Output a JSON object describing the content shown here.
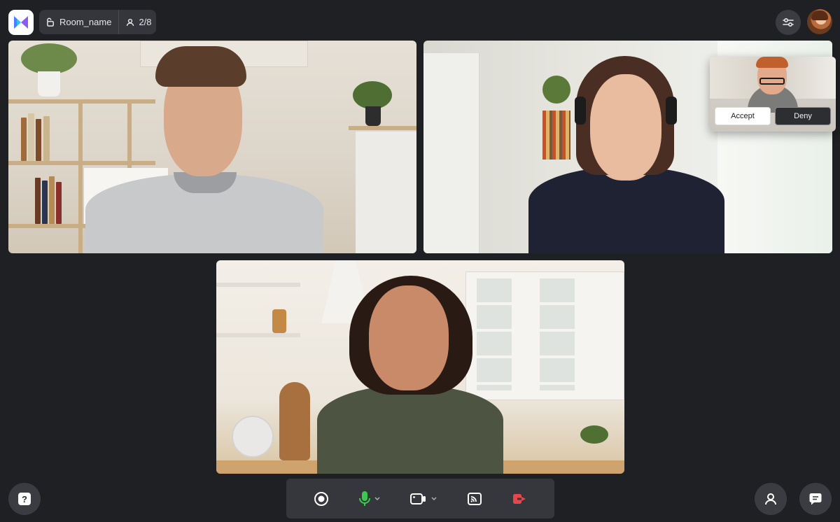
{
  "header": {
    "room_name": "Room_name",
    "participant_count": "2/8"
  },
  "join_request": {
    "accept_label": "Accept",
    "deny_label": "Deny"
  },
  "help": {
    "label": "?"
  },
  "icons": {
    "logo": "app-logo-icon",
    "lock": "unlock-icon",
    "participants": "user-icon",
    "settings": "sliders-icon",
    "record": "record-icon",
    "mic": "microphone-icon",
    "camera": "video-camera-icon",
    "cast": "cast-icon",
    "leave": "leave-icon",
    "chat": "chat-bubble-icon"
  },
  "colors": {
    "background": "#1f2023",
    "panel": "#35373c",
    "mic_active": "#3cc94f",
    "leave": "#e8464a",
    "logo_accent": "#6b5cf0"
  }
}
